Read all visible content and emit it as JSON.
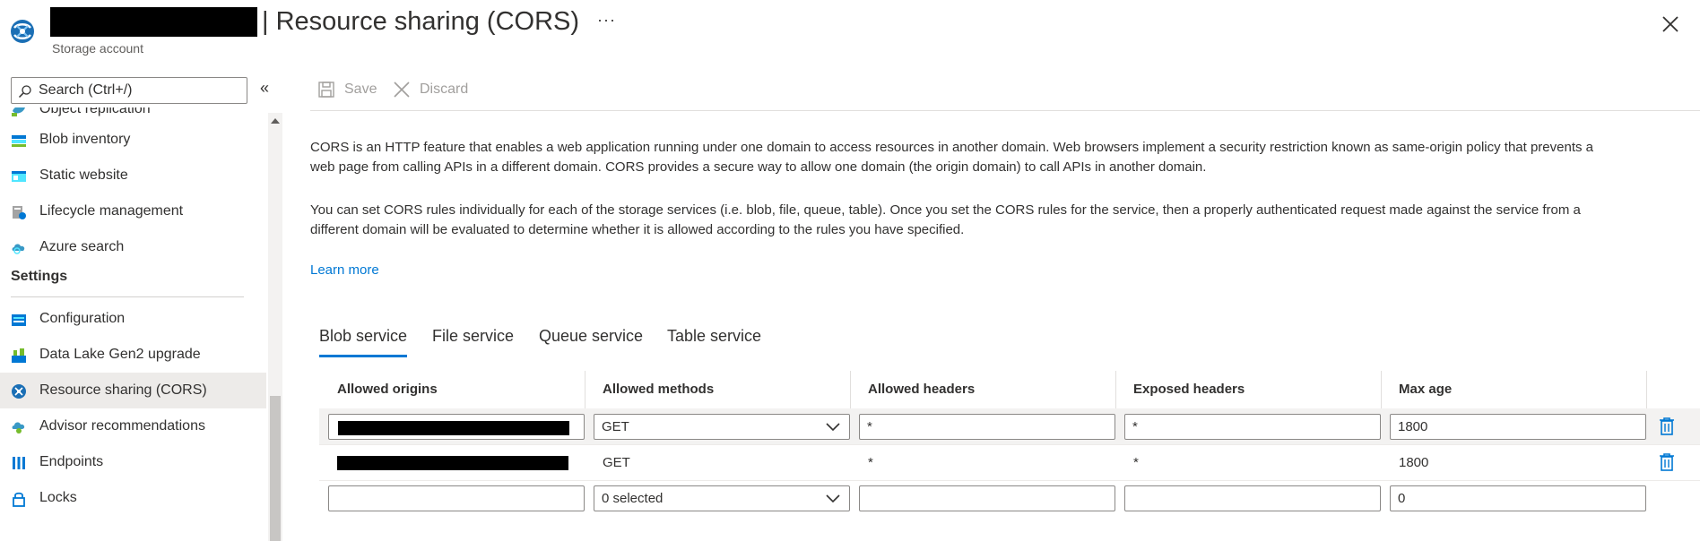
{
  "header": {
    "title": "| Resource sharing (CORS)",
    "subtitle": "Storage account",
    "more_label": "···",
    "close_icon": "close-icon",
    "logo_icon": "storage-cors-logo-icon"
  },
  "sidebar": {
    "search_placeholder": "Search (Ctrl+/)",
    "collapse_label": "«",
    "items_top": [
      {
        "label": "Object replication",
        "icon": "object-replication-icon"
      },
      {
        "label": "Blob inventory",
        "icon": "blob-inventory-icon"
      },
      {
        "label": "Static website",
        "icon": "static-website-icon"
      },
      {
        "label": "Lifecycle management",
        "icon": "lifecycle-management-icon"
      },
      {
        "label": "Azure search",
        "icon": "azure-search-icon"
      }
    ],
    "section_settings": "Settings",
    "items_settings": [
      {
        "label": "Configuration",
        "icon": "configuration-icon"
      },
      {
        "label": "Data Lake Gen2 upgrade",
        "icon": "data-lake-icon"
      },
      {
        "label": "Resource sharing (CORS)",
        "icon": "cors-icon"
      },
      {
        "label": "Advisor recommendations",
        "icon": "advisor-icon"
      },
      {
        "label": "Endpoints",
        "icon": "endpoints-icon"
      },
      {
        "label": "Locks",
        "icon": "lock-icon"
      }
    ]
  },
  "toolbar": {
    "save_label": "Save",
    "discard_label": "Discard"
  },
  "main": {
    "paragraph1_line1": "CORS is an HTTP feature that enables a web application running under one domain to access resources in another domain. Web browsers implement a security restriction known as same-origin policy that prevents a",
    "paragraph1_line2": "web page from calling APIs in a different domain. CORS provides a secure way to allow one domain (the origin domain) to call APIs in another domain.",
    "paragraph2_line1": "You can set CORS rules individually for each of the storage services (i.e. blob, file, queue, table). Once you set the CORS rules for the service, then a properly authenticated request made against the service from a",
    "paragraph2_line2": "different domain will be evaluated to determine whether it is allowed according to the rules you have specified.",
    "learn_more": "Learn more"
  },
  "tabs": [
    {
      "label": "Blob service",
      "active": true
    },
    {
      "label": "File service",
      "active": false
    },
    {
      "label": "Queue service",
      "active": false
    },
    {
      "label": "Table service",
      "active": false
    }
  ],
  "table": {
    "headers": [
      "Allowed origins",
      "Allowed methods",
      "Allowed headers",
      "Exposed headers",
      "Max age"
    ],
    "rows": [
      {
        "methods": "GET",
        "allowed_headers": "*",
        "exposed_headers": "*",
        "max_age": "1800"
      },
      {
        "methods": "GET",
        "allowed_headers": "*",
        "exposed_headers": "*",
        "max_age": "1800"
      },
      {
        "origins": "",
        "methods": "0 selected",
        "allowed_headers": "",
        "exposed_headers": "",
        "max_age": "0"
      }
    ]
  },
  "colors": {
    "accent": "#0078d4",
    "text": "#323130",
    "disabled": "#a19f9d"
  }
}
